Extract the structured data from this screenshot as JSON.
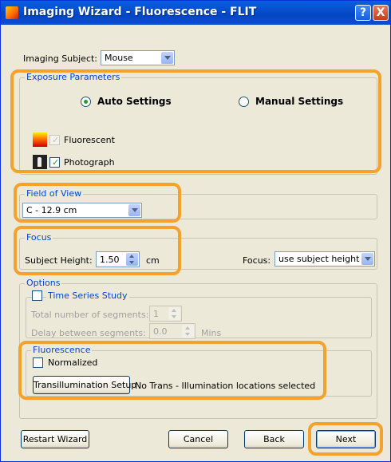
{
  "window": {
    "title": "Imaging Wizard - Fluorescence - FLIT",
    "help_glyph": "?",
    "close_glyph": "X"
  },
  "imaging_subject": {
    "label": "Imaging Subject:",
    "value": "Mouse"
  },
  "exposure": {
    "legend": "Exposure Parameters",
    "auto_label": "Auto Settings",
    "manual_label": "Manual Settings",
    "selected": "auto",
    "fluorescent_label": "Fluorescent",
    "fluorescent_checked": true,
    "fluorescent_enabled": false,
    "photograph_label": "Photograph",
    "photograph_checked": true
  },
  "field_of_view": {
    "legend": "Field of View",
    "value": "C - 12.9 cm"
  },
  "focus": {
    "legend": "Focus",
    "height_label": "Subject Height:",
    "height_value": "1.50",
    "height_unit": "cm",
    "focus_label": "Focus:",
    "focus_value": "use subject height"
  },
  "options": {
    "legend": "Options",
    "time_series_label": "Time Series Study",
    "time_series_checked": false,
    "segments_label": "Total number of segments:",
    "segments_value": "1",
    "delay_label": "Delay between segments:",
    "delay_value": "0.0",
    "delay_unit": "Mins"
  },
  "fluorescence": {
    "legend": "Fluorescence",
    "normalized_label": "Normalized",
    "normalized_checked": false,
    "transillum_button": "Transillumination Setup",
    "transillum_status": "No Trans - Illumination locations selected"
  },
  "footer": {
    "restart": "Restart Wizard",
    "cancel": "Cancel",
    "back": "Back",
    "next": "Next"
  },
  "colors": {
    "titlebar": "#0a5fe0",
    "highlight": "#f5a12a",
    "legend_text": "#0046d5",
    "dialog_bg": "#ece9d8"
  },
  "checkmark_glyph": "✓"
}
